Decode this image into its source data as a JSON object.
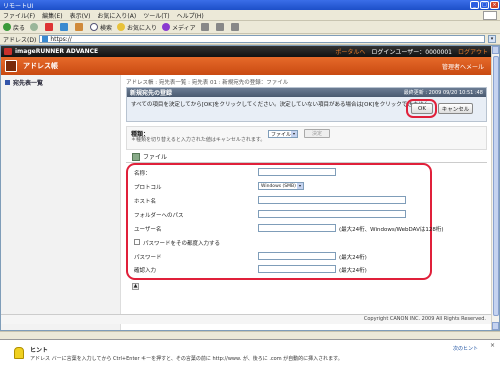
{
  "window": {
    "title": "リモートUI",
    "controls": {
      "minimize": "_",
      "maximize": "□",
      "close": "×"
    }
  },
  "menubar": {
    "items": [
      "ファイル(F)",
      "編集(E)",
      "表示(V)",
      "お気に入り(A)",
      "ツール(T)",
      "ヘルプ(H)"
    ]
  },
  "toolbar": {
    "back_label": "戻る",
    "search_label": "検索",
    "favorites_label": "お気に入り",
    "media_label": "メディア"
  },
  "addressbar": {
    "label": "アドレス(D)",
    "url": "https://"
  },
  "page": {
    "product": "imageRUNNER ADVANCE",
    "portal_link": "ポータルへ",
    "login_user_label": "ログインユーザー：",
    "login_user_id": "0000001",
    "logout_link": "ログアウト",
    "app_title": "アドレス帳",
    "admin_mail": "管理者へメール",
    "sidebar": {
      "items": [
        {
          "label": "宛先表一覧"
        }
      ]
    },
    "breadcrumb": "アドレス帳 : 宛先表一覧 : 宛先表 01 : 新規宛先の登録：ファイル",
    "register_panel": {
      "title": "新規宛先の登録",
      "updated": "最終更新 : 2009 09/20 10:51 :48",
      "message": "すべての項目を決定してから[OK]をクリックしてください。決定していない項目がある場合は[OK]をクリックできません。",
      "ok": "OK",
      "cancel": "キャンセル"
    },
    "type_panel": {
      "label": "種類：",
      "note": "＊種類を切り替えると入力された値はキャンセルされます。",
      "selected": "ファイル",
      "set_button": "決定"
    },
    "section_title": "ファイル",
    "form": {
      "name_label": "名称：",
      "protocol_label": "プロトコル",
      "protocol_value": "Windows (SMB)",
      "host_label": "ホスト名",
      "folder_label": "フォルダーへのパス",
      "user_label": "ユーザー名",
      "user_note": "(最大24桁、Windows/WebDAVは128桁)",
      "confirm_checkbox": "パスワードをその都度入力する",
      "password_label": "パスワード",
      "password_note": "(最大24桁)",
      "confirm_label": "確認入力",
      "confirm_note": "(最大24桁)"
    },
    "footer": "Copyright CANON INC. 2009 All Rights Reserved."
  },
  "hint": {
    "label": "ヒント",
    "text": "アドレス バーに言葉を入力してから Ctrl+Enter キーを押すと、その言葉の前に http://www. が、後ろに .com が自動的に挿入されます。",
    "next": "次のヒント"
  }
}
